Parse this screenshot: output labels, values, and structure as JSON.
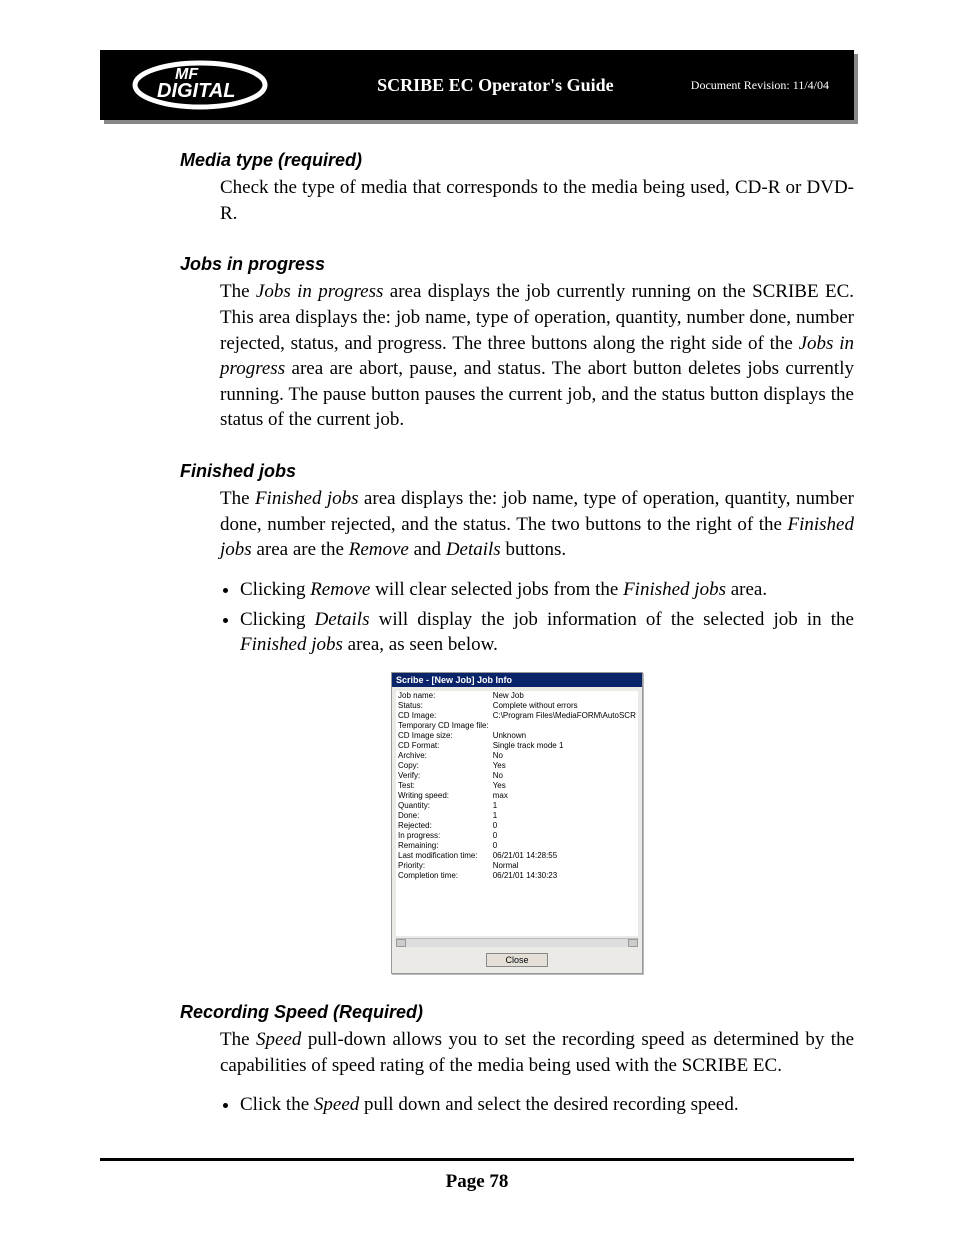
{
  "header": {
    "title": "SCRIBE EC Operator's Guide",
    "revision": "Document Revision: 11/4/04",
    "logo_top": "MF",
    "logo_bottom": "DIGITAL"
  },
  "sections": {
    "media_type": {
      "heading": "Media type (required)",
      "body": "Check the type of media that corresponds to the media being used, CD-R or DVD-R."
    },
    "jobs_in_progress": {
      "heading": "Jobs in progress",
      "body_pre": "The ",
      "body_em": "Jobs in progress",
      "body_mid": " area displays the job currently running on the SCRIBE EC. This area displays the: job name, type of operation, quantity, number done, number rejected, status, and progress. The three buttons along the right side of the ",
      "body_em2": "Jobs in progress",
      "body_post": " area are abort, pause, and status. The abort button deletes jobs currently running. The pause button pauses the current job, and the status button displays the status of the current job."
    },
    "finished_jobs": {
      "heading": "Finished jobs",
      "body_pre": "The ",
      "body_em": "Finished jobs",
      "body_mid": " area displays the: job name, type of operation, quantity, number done, number rejected, and the status. The two buttons to the right of the ",
      "body_em2": "Finished jobs",
      "body_mid2": " area are the ",
      "body_em3": "Remove",
      "body_mid3": " and ",
      "body_em4": "Details",
      "body_post": " buttons.",
      "bullet1_pre": "Clicking ",
      "bullet1_em": "Remove",
      "bullet1_mid": " will clear selected jobs from the ",
      "bullet1_em2": "Finished jobs",
      "bullet1_post": " area.",
      "bullet2_pre": "Clicking ",
      "bullet2_em": "Details",
      "bullet2_mid": " will display the job information of the selected job in the ",
      "bullet2_em2": "Finished jobs",
      "bullet2_post": " area, as seen below."
    },
    "recording_speed": {
      "heading": "Recording Speed (Required)",
      "body_pre": "The ",
      "body_em": "Speed",
      "body_post": " pull-down allows you to set the recording speed as determined by the capabilities of speed rating of the media being used with the SCRIBE EC.",
      "bullet_pre": "Click the ",
      "bullet_em": "Speed",
      "bullet_post": " pull down and select the desired recording speed."
    }
  },
  "dialog": {
    "title": "Scribe - [New Job] Job Info",
    "close": "Close",
    "rows": [
      {
        "k": "Job name:",
        "v": "New Job"
      },
      {
        "k": "Status:",
        "v": "Complete without errors"
      },
      {
        "k": "CD Image:",
        "v": "C:\\Program Files\\MediaFORM\\AutoSCR"
      },
      {
        "k": "Temporary CD Image file:",
        "v": ""
      },
      {
        "k": "CD Image size:",
        "v": "Unknown"
      },
      {
        "k": "CD Format:",
        "v": "Single track mode 1"
      },
      {
        "k": "Archive:",
        "v": "No"
      },
      {
        "k": "Copy:",
        "v": "Yes"
      },
      {
        "k": "Verify:",
        "v": "No"
      },
      {
        "k": "Test:",
        "v": "Yes"
      },
      {
        "k": "Writing speed:",
        "v": "max"
      },
      {
        "k": "Quantity:",
        "v": "1"
      },
      {
        "k": "Done:",
        "v": "1"
      },
      {
        "k": "Rejected:",
        "v": "0"
      },
      {
        "k": "In progress:",
        "v": "0"
      },
      {
        "k": "Remaining:",
        "v": "0"
      },
      {
        "k": "Last modification time:",
        "v": "06/21/01 14:28:55"
      },
      {
        "k": "Priority:",
        "v": "Normal"
      },
      {
        "k": "Completion time:",
        "v": "06/21/01 14:30:23"
      }
    ]
  },
  "footer": {
    "page": "Page 78"
  }
}
